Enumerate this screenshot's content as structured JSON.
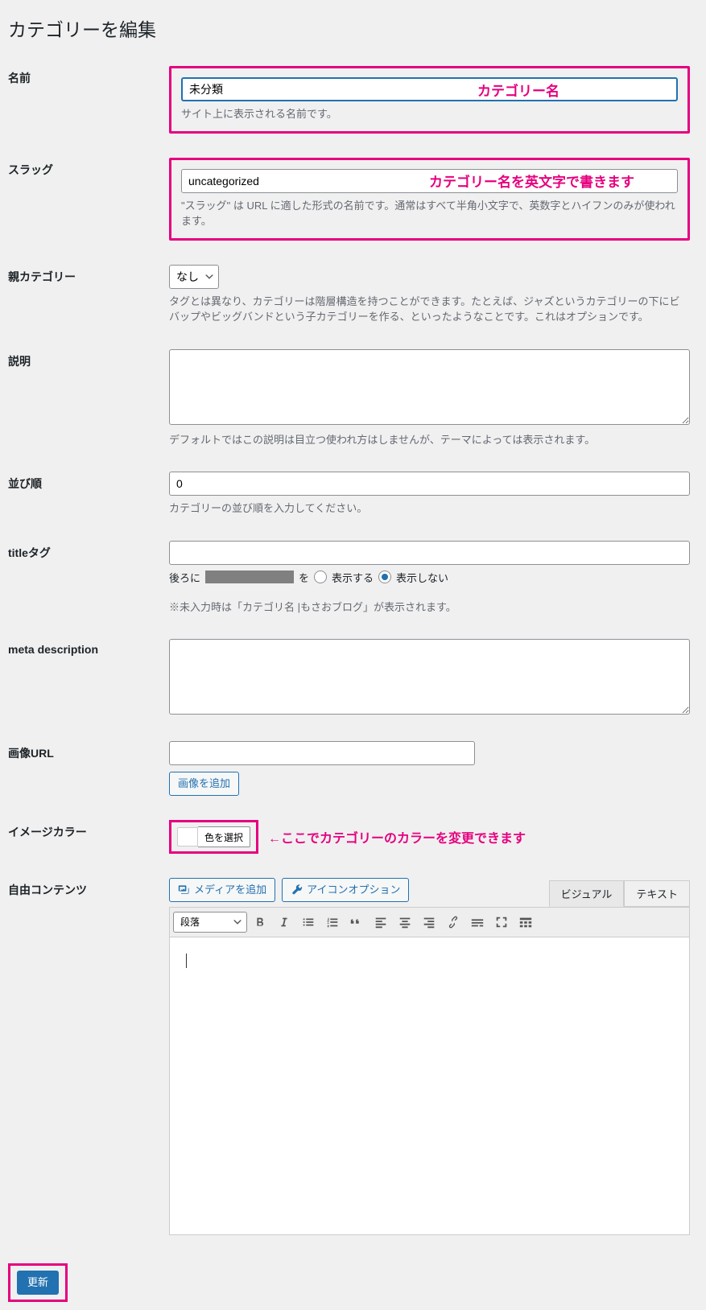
{
  "page": {
    "title": "カテゴリーを編集"
  },
  "annotations": {
    "name": "カテゴリー名",
    "slug": "カテゴリー名を英文字で書きます",
    "color": "←ここでカテゴリーのカラーを変更できます"
  },
  "fields": {
    "name": {
      "label": "名前",
      "value": "未分類",
      "desc": "サイト上に表示される名前です。"
    },
    "slug": {
      "label": "スラッグ",
      "value": "uncategorized",
      "desc": "\"スラッグ\" は URL に適した形式の名前です。通常はすべて半角小文字で、英数字とハイフンのみが使われます。"
    },
    "parent": {
      "label": "親カテゴリー",
      "selected": "なし",
      "desc": "タグとは異なり、カテゴリーは階層構造を持つことができます。たとえば、ジャズというカテゴリーの下にビバップやビッグバンドという子カテゴリーを作る、といったようなことです。これはオプションです。"
    },
    "description": {
      "label": "説明",
      "value": "",
      "desc": "デフォルトではこの説明は目立つ使われ方はしませんが、テーマによっては表示されます。"
    },
    "order": {
      "label": "並び順",
      "value": "0",
      "desc": "カテゴリーの並び順を入力してください。"
    },
    "titletag": {
      "label": "titleタグ",
      "value": "",
      "radio_prefix": "後ろに",
      "radio_mid": "を",
      "radio_show": "表示する",
      "radio_hide": "表示しない",
      "desc": "※未入力時は「カテゴリ名 |もさおブログ」が表示されます。"
    },
    "metadesc": {
      "label": "meta description",
      "value": ""
    },
    "imageurl": {
      "label": "画像URL",
      "value": "",
      "btn": "画像を追加"
    },
    "imagecolor": {
      "label": "イメージカラー",
      "btn": "色を選択"
    },
    "freecontent": {
      "label": "自由コンテンツ",
      "media_btn": "メディアを追加",
      "icon_btn": "アイコンオプション",
      "tab_visual": "ビジュアル",
      "tab_text": "テキスト",
      "format_select": "段落"
    }
  },
  "submit": {
    "label": "更新"
  }
}
